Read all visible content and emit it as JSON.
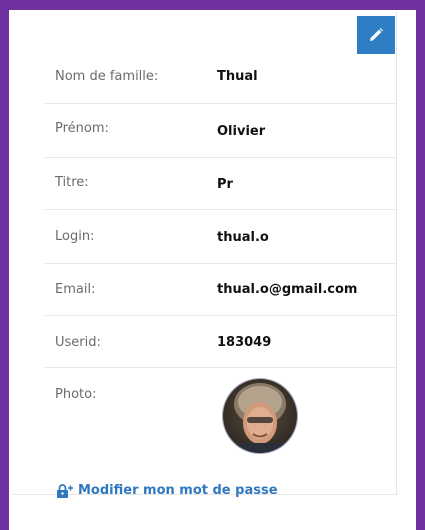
{
  "profile": {
    "fields": [
      {
        "label": "Nom de famille:",
        "value": "Thual"
      },
      {
        "label": "Prénom:",
        "value": "Olivier"
      },
      {
        "label": "Titre:",
        "value": "Pr"
      },
      {
        "label": "Login:",
        "value": "thual.o"
      },
      {
        "label": "Email:",
        "value": "thual.o@gmail.com"
      },
      {
        "label": "Userid:",
        "value": "183049"
      }
    ],
    "photo_label": "Photo:",
    "change_password_label": "Modifier mon mot de passe"
  },
  "icons": {
    "edit": "pencil-icon",
    "lock": "lock-icon"
  },
  "colors": {
    "frame": "#7030a0",
    "accent": "#2f7dc3",
    "link": "#2f78c0"
  }
}
